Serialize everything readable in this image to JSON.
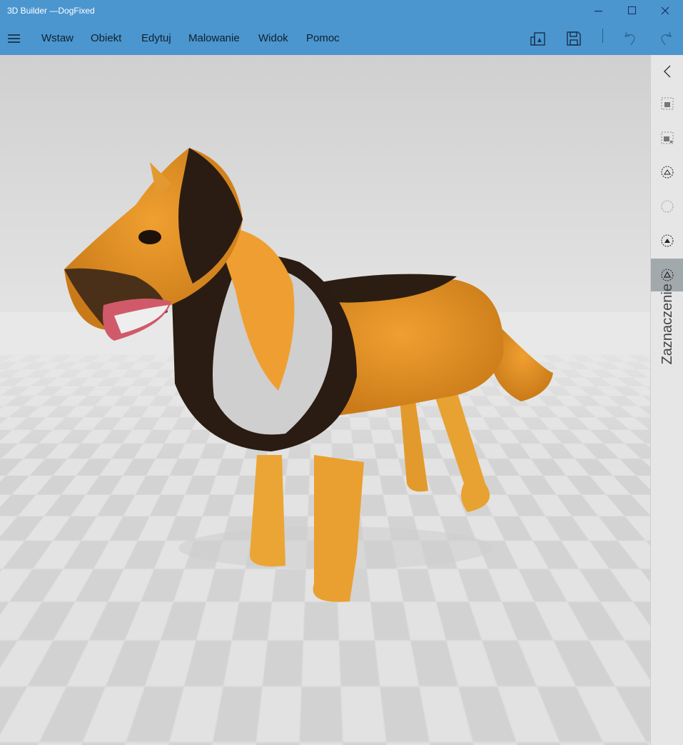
{
  "window": {
    "title": "3D Builder —DogFixed"
  },
  "menu": [
    "Wstaw",
    "Obiekt",
    "Edytuj",
    "Malowanie",
    "Widok",
    "Pomoc"
  ],
  "side_panel": {
    "label": "Zaznaczenie",
    "active_index": 5
  },
  "colors": {
    "accent": "#4b96cf",
    "panel": "#e6e6e6",
    "active_item": "#a2a9ad"
  }
}
